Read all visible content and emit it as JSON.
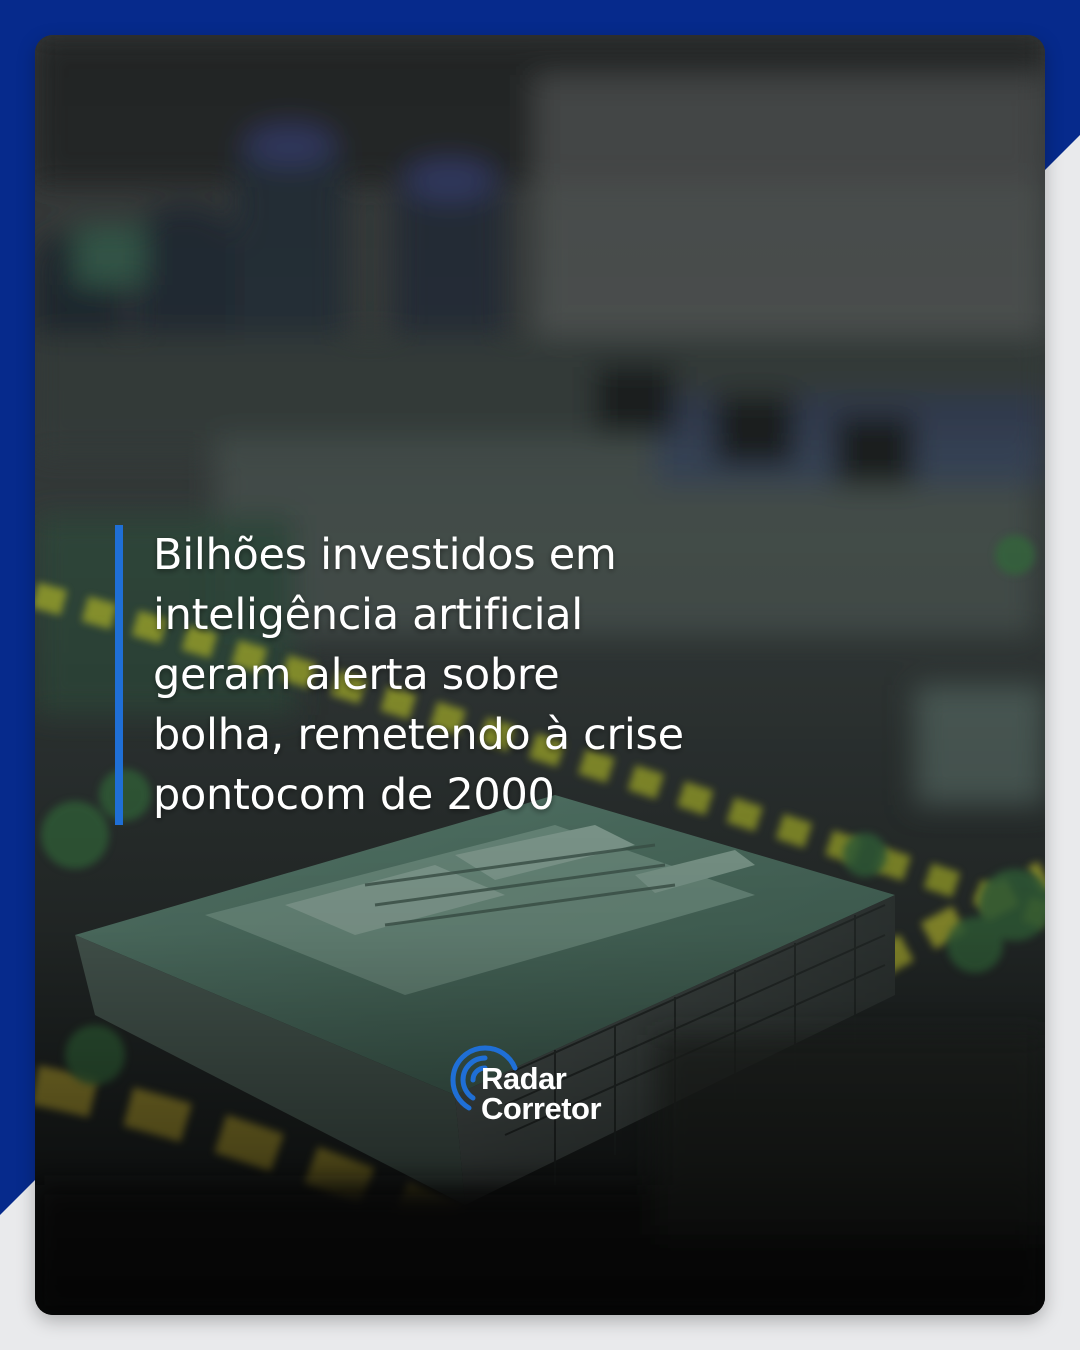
{
  "headline": {
    "lines": [
      "Bilhões investidos em",
      "inteligência artificial",
      "geram alerta sobre",
      "bolha, remetendo à crise",
      "pontocom de 2000"
    ]
  },
  "brand": {
    "line1": "Radar",
    "line2": "Corretor",
    "icon": "radar-signal-icon"
  },
  "colors": {
    "frame_blue": "#062a8c",
    "accent_blue": "#1f6fd6",
    "background": "#e9eaec",
    "text": "#ffffff"
  }
}
